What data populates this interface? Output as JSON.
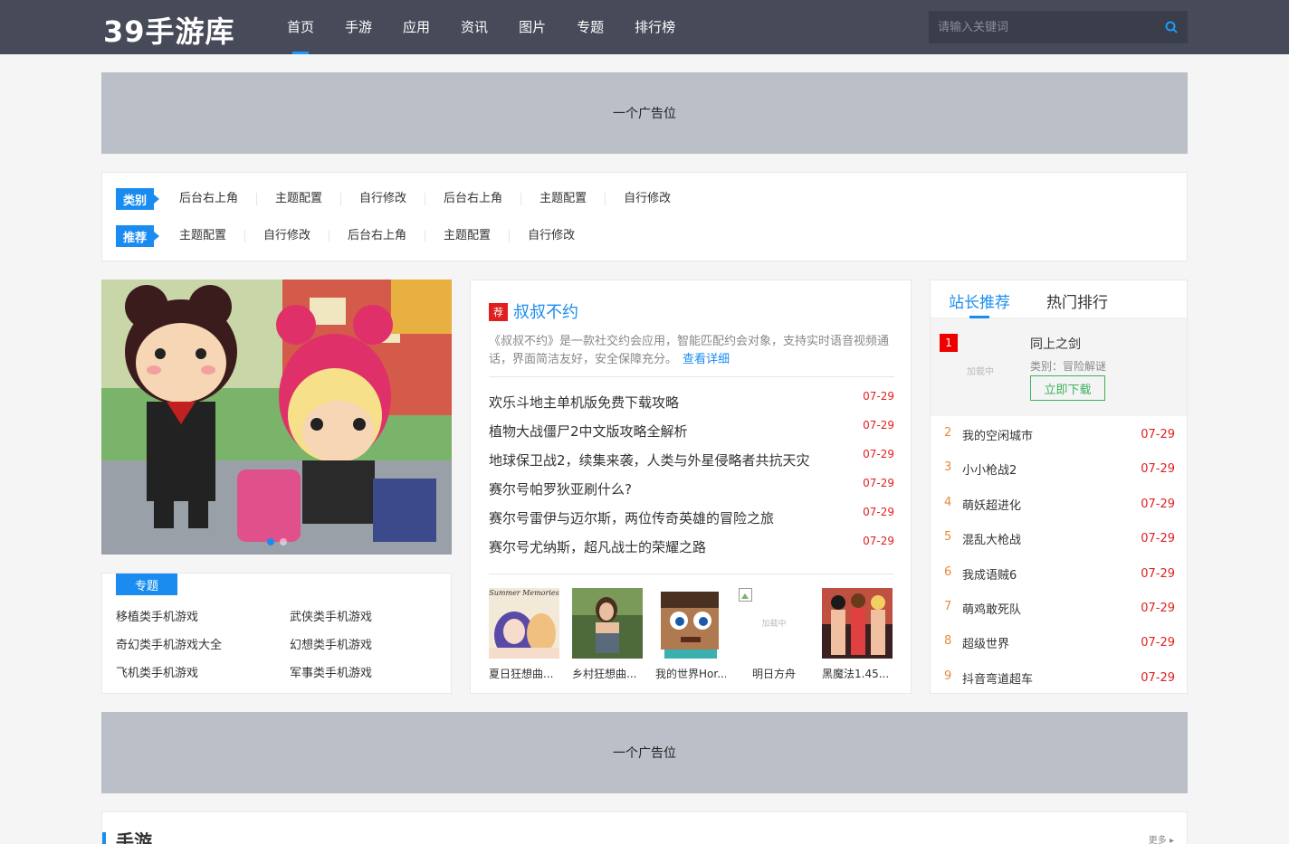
{
  "header": {
    "logo": "39手游库",
    "nav": [
      "首页",
      "手游",
      "应用",
      "资讯",
      "图片",
      "专题",
      "排行榜"
    ],
    "search_placeholder": "请输入关键词"
  },
  "ads": {
    "top": "一个广告位",
    "bottom": "一个广告位"
  },
  "filters": {
    "category": {
      "tag": "类别",
      "links": [
        "后台右上角",
        "主题配置",
        "自行修改",
        "后台右上角",
        "主题配置",
        "自行修改"
      ]
    },
    "recommend": {
      "tag": "推荐",
      "links": [
        "主题配置",
        "自行修改",
        "后台右上角",
        "主题配置",
        "自行修改"
      ]
    }
  },
  "topics": {
    "tag": "专题",
    "items": [
      "移植类手机游戏",
      "武侠类手机游戏",
      "奇幻类手机游戏大全",
      "幻想类手机游戏",
      "飞机类手机游戏",
      "军事类手机游戏"
    ]
  },
  "featured": {
    "badge": "荐",
    "title": "叔叔不约",
    "desc": "《叔叔不约》是一款社交约会应用，智能匹配约会对象，支持实时语音视频通话，界面简洁友好，安全保障充分。",
    "more": "查看详细"
  },
  "news": [
    {
      "title": "欢乐斗地主单机版免费下载攻略",
      "date": "07-29"
    },
    {
      "title": "植物大战僵尸2中文版攻略全解析",
      "date": "07-29"
    },
    {
      "title": "地球保卫战2，续集来袭，人类与外星侵略者共抗天灾",
      "date": "07-29"
    },
    {
      "title": "赛尔号帕罗狄亚刷什么?",
      "date": "07-29"
    },
    {
      "title": "赛尔号雷伊与迈尔斯，两位传奇英雄的冒险之旅",
      "date": "07-29"
    },
    {
      "title": "赛尔号尤纳斯，超凡战士的荣耀之路",
      "date": "07-29"
    }
  ],
  "thumbs": [
    {
      "name": "夏日狂想曲...",
      "caption": "Summer Memories"
    },
    {
      "name": "乡村狂想曲..."
    },
    {
      "name": "我的世界Hor..."
    },
    {
      "name": "明日方舟",
      "loading": "加载中"
    },
    {
      "name": "黑魔法1.45..."
    }
  ],
  "ranking": {
    "tabs": [
      "站长推荐",
      "热门排行"
    ],
    "top": {
      "no": "1",
      "name": "同上之剑",
      "category": "类别：冒险解谜",
      "download": "立即下载",
      "loading": "加载中"
    },
    "items": [
      {
        "no": "2",
        "name": "我的空闲城市",
        "date": "07-29"
      },
      {
        "no": "3",
        "name": "小小枪战2",
        "date": "07-29"
      },
      {
        "no": "4",
        "name": "萌妖超进化",
        "date": "07-29"
      },
      {
        "no": "5",
        "name": "混乱大枪战",
        "date": "07-29"
      },
      {
        "no": "6",
        "name": "我成语贼6",
        "date": "07-29"
      },
      {
        "no": "7",
        "name": "萌鸡敢死队",
        "date": "07-29"
      },
      {
        "no": "8",
        "name": "超级世界",
        "date": "07-29"
      },
      {
        "no": "9",
        "name": "抖音弯道超车",
        "date": "07-29"
      }
    ]
  },
  "section": {
    "title": "手游",
    "more": "更多"
  },
  "colors": {
    "header": "#474a59",
    "accent": "#1a8cf0",
    "red": "#e02020",
    "ad": "#babfc8"
  }
}
